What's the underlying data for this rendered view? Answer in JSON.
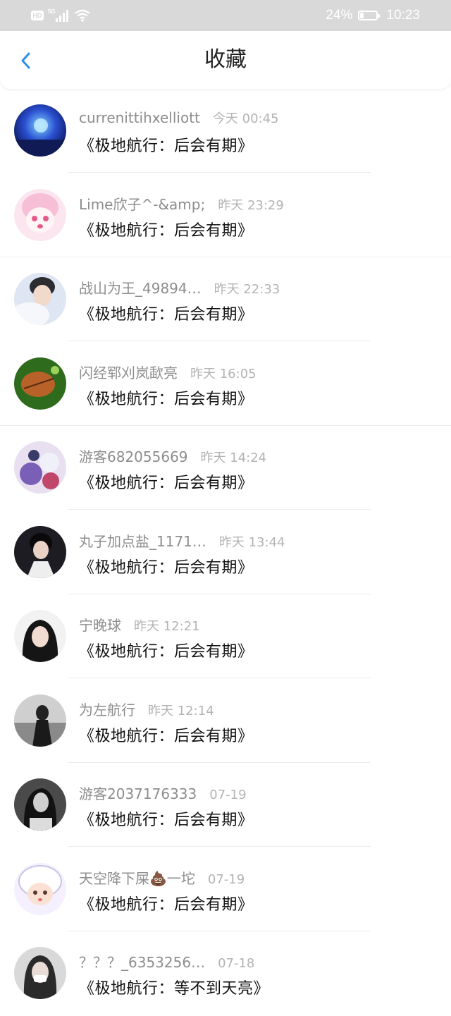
{
  "status_bar": {
    "hd": "HD",
    "network": "5G",
    "battery_pct": "24%",
    "battery_level": 0.24,
    "time": "10:23"
  },
  "header": {
    "title": "收藏"
  },
  "items": [
    {
      "user": "currenittihxelliott",
      "time": "今天 00:45",
      "title": "《极地航行：后会有期》"
    },
    {
      "user": "Lime欣子^-&amp;",
      "time": "昨天 23:29",
      "title": "《极地航行：后会有期》"
    },
    {
      "user": "战山为王_49894…",
      "time": "昨天 22:33",
      "title": "《极地航行：后会有期》"
    },
    {
      "user": "闪经郓刈岚歃亮",
      "time": "昨天 16:05",
      "title": "《极地航行：后会有期》"
    },
    {
      "user": "游客682055669",
      "time": "昨天 14:24",
      "title": "《极地航行：后会有期》"
    },
    {
      "user": "丸子加点盐_1171…",
      "time": "昨天 13:44",
      "title": "《极地航行：后会有期》"
    },
    {
      "user": "宁晚球",
      "time": "昨天 12:21",
      "title": "《极地航行：后会有期》"
    },
    {
      "user": "为左航行",
      "time": "昨天 12:14",
      "title": "《极地航行：后会有期》"
    },
    {
      "user": "游客2037176333",
      "time": "07-19",
      "title": "《极地航行：后会有期》"
    },
    {
      "user": "天空降下屎💩一坨",
      "time": "07-19",
      "title": "《极地航行：后会有期》"
    },
    {
      "user": "？？？_6353256…",
      "time": "07-18",
      "title": "《极地航行：等不到天亮》"
    }
  ],
  "colors": {
    "accent": "#2f8fe8",
    "status_bar_bg": "#d9d9d9",
    "username": "#8d8d8d",
    "timestamp": "#b3b3b3"
  }
}
